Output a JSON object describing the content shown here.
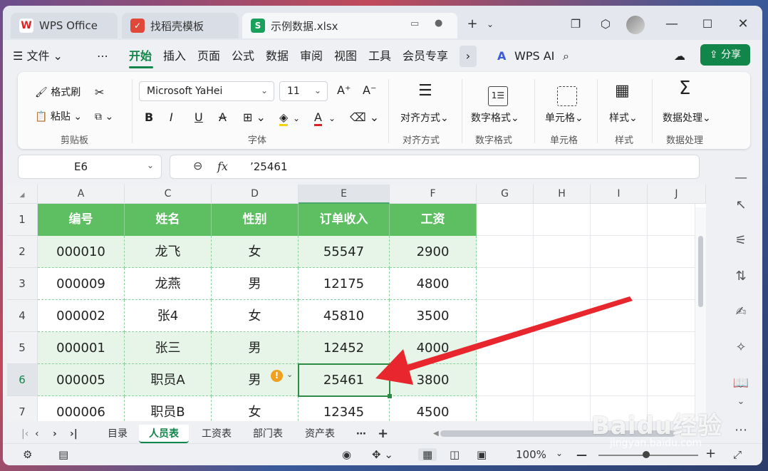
{
  "tabs": [
    {
      "label": "WPS Office",
      "icon": "wps-logo-icon"
    },
    {
      "label": "找稻壳模板",
      "icon": "docer-icon"
    },
    {
      "label": "示例数据.xlsx",
      "icon": "sheet-file-icon",
      "icon_letter": "S"
    }
  ],
  "menu": {
    "file": "文件",
    "items": [
      "开始",
      "插入",
      "页面",
      "公式",
      "数据",
      "审阅",
      "视图",
      "工具",
      "会员专享"
    ],
    "wps_ai": "WPS AI",
    "share": "分享"
  },
  "ribbon": {
    "format_painter": "格式刷",
    "paste": "粘贴",
    "clipboard_group": "剪贴板",
    "font_name": "Microsoft YaHei",
    "font_size": "11",
    "font_group": "字体",
    "align_btn": "对齐方式",
    "align_group": "对齐方式",
    "number_btn": "数字格式",
    "number_group": "数字格式",
    "cell_btn": "单元格",
    "cell_group": "单元格",
    "style_btn": "样式",
    "style_group": "样式",
    "data_btn": "数据处理",
    "data_group": "数据处理"
  },
  "formula": {
    "cell_ref": "E6",
    "fx": "fx",
    "content": "’25461"
  },
  "columns": [
    "A",
    "C",
    "D",
    "E",
    "F",
    "G",
    "H",
    "I",
    "J"
  ],
  "rows": [
    "1",
    "2",
    "3",
    "4",
    "5",
    "6",
    "7"
  ],
  "table": {
    "headers": [
      "编号",
      "姓名",
      "性别",
      "订单收入",
      "工资"
    ],
    "data": [
      [
        "000010",
        "龙飞",
        "女",
        "55547",
        "2900"
      ],
      [
        "000009",
        "龙燕",
        "男",
        "12175",
        "4800"
      ],
      [
        "000002",
        "张4",
        "女",
        "45810",
        "3500"
      ],
      [
        "000001",
        "张三",
        "男",
        "12452",
        "4000"
      ],
      [
        "000005",
        "职员A",
        "男",
        "25461",
        "3800"
      ],
      [
        "000006",
        "职员B",
        "女",
        "12345",
        "4500"
      ]
    ]
  },
  "sheets": [
    "目录",
    "人员表",
    "工资表",
    "部门表",
    "资产表"
  ],
  "active_sheet": "人员表",
  "status": {
    "zoom": "100%"
  },
  "watermark": "Baidu经验",
  "watermark_sub": "jingyan.baidu.com",
  "colors": {
    "accent": "#12854a",
    "header_fill": "#5dbe62",
    "band_fill": "#e6f5e7",
    "arrow": "#e8262e"
  }
}
